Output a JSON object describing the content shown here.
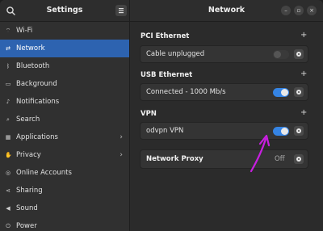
{
  "window": {
    "left_title": "Settings",
    "right_title": "Network"
  },
  "header": {
    "minimize_glyph": "–",
    "maximize_glyph": "▫",
    "close_glyph": "×"
  },
  "sidebar": {
    "items": [
      {
        "label": "Wi-Fi",
        "icon": "wifi-icon",
        "glyph": "⌔"
      },
      {
        "label": "Network",
        "icon": "network-icon",
        "glyph": "⇄"
      },
      {
        "label": "Bluetooth",
        "icon": "bluetooth-icon",
        "glyph": "ᛒ"
      },
      {
        "label": "Background",
        "icon": "background-icon",
        "glyph": "▭"
      },
      {
        "label": "Notifications",
        "icon": "bell-icon",
        "glyph": "♪"
      },
      {
        "label": "Search",
        "icon": "search-icon",
        "glyph": "⌕"
      },
      {
        "label": "Applications",
        "icon": "apps-icon",
        "glyph": "▦"
      },
      {
        "label": "Privacy",
        "icon": "hand-icon",
        "glyph": "✋"
      },
      {
        "label": "Online Accounts",
        "icon": "accounts-icon",
        "glyph": "◎"
      },
      {
        "label": "Sharing",
        "icon": "share-icon",
        "glyph": "⋖"
      },
      {
        "label": "Sound",
        "icon": "speaker-icon",
        "glyph": "◀"
      },
      {
        "label": "Power",
        "icon": "power-icon",
        "glyph": "⏻"
      }
    ],
    "selected_index": 1
  },
  "sections": {
    "pci": {
      "title": "PCI Ethernet",
      "add": "+",
      "row_label": "Cable unplugged",
      "toggle_on": false
    },
    "usb": {
      "title": "USB Ethernet",
      "add": "+",
      "row_label": "Connected - 1000 Mb/s",
      "toggle_on": true
    },
    "vpn": {
      "title": "VPN",
      "add": "+",
      "row_label": "odvpn VPN",
      "toggle_on": true
    },
    "proxy": {
      "title": "Network Proxy",
      "status": "Off"
    }
  },
  "colors": {
    "accent": "#3584e4",
    "selected": "#2d63b0",
    "annotation_arrow": "#c81fe0"
  }
}
